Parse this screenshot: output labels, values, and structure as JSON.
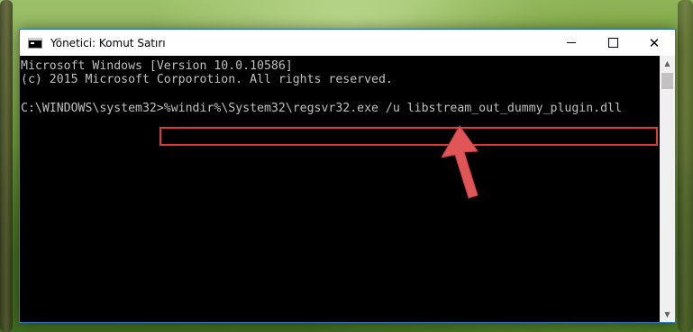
{
  "window": {
    "title": "Yönetici: Komut Satırı",
    "minimize_label": "—",
    "maximize_label": "☐",
    "close_label": "✕"
  },
  "console": {
    "lines": [
      "Microsoft Windows [Version 10.0.10586]",
      "(c) 2015 Microsoft Corporotion. All rights reserved."
    ],
    "prompt": "C:\\WINDOWS\\system32>",
    "command": "%windir%\\System32\\regsvr32.exe /u libstream_out_dummy_plugin.dll"
  },
  "scrollbar": {
    "up_arrow": "▲",
    "down_arrow": "▼"
  },
  "colors": {
    "console_bg": "#000000",
    "console_text": "#c0c0c0",
    "highlight_border": "#e03a3a",
    "annotation_arrow": "#e05555"
  },
  "icons": {
    "app": "console-app-icon",
    "annotation": "red-arrow-pointer-icon"
  }
}
